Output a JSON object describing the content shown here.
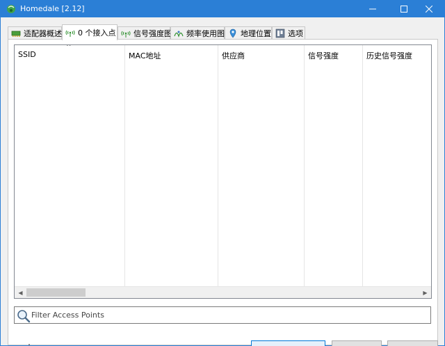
{
  "window": {
    "title": "Homedale [2.12]"
  },
  "tabs": [
    {
      "label": "适配器概述",
      "icon": "adapter-icon",
      "active": false
    },
    {
      "label": "0 个接入点",
      "icon": "wifi-signal-icon",
      "active": true
    },
    {
      "label": "信号强度图",
      "icon": "wifi-signal-icon",
      "active": false
    },
    {
      "label": "频率使用图",
      "icon": "frequency-icon",
      "active": false
    },
    {
      "label": "地理位置",
      "icon": "location-pin-icon",
      "active": false
    },
    {
      "label": "选项",
      "icon": "options-icon",
      "active": false
    }
  ],
  "list": {
    "columns": [
      "SSID",
      "MAC地址",
      "供应商",
      "信号强度",
      "历史信号强度"
    ],
    "sorted_column": "SSID",
    "rows": []
  },
  "filter": {
    "placeholder": "Filter Access Points",
    "value": ""
  },
  "colors": {
    "titlebar": "#2b7fd6",
    "window_bg": "#f0f0f0",
    "accent_button_border": "#0078d7"
  }
}
